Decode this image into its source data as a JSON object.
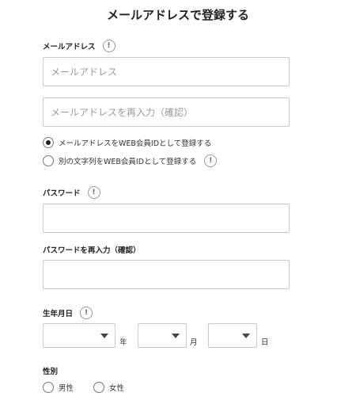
{
  "page": {
    "title": "メールアドレスで登録する"
  },
  "email": {
    "label": "メールアドレス",
    "help": "!",
    "placeholder": "メールアドレス",
    "confirm_placeholder": "メールアドレスを再入力（確認）"
  },
  "member_id": {
    "options": [
      {
        "label": "メールアドレスをWEB会員IDとして登録する",
        "checked": true
      },
      {
        "label": "別の文字列をWEB会員IDとして登録する",
        "checked": false
      }
    ],
    "help": "!"
  },
  "password": {
    "label": "パスワード",
    "help": "!",
    "value": ""
  },
  "password_confirm": {
    "label": "パスワードを再入力（確認）",
    "value": ""
  },
  "birthdate": {
    "label": "生年月日",
    "help": "!",
    "year_unit": "年",
    "month_unit": "月",
    "day_unit": "日",
    "year_value": "",
    "month_value": "",
    "day_value": ""
  },
  "gender": {
    "label": "性別",
    "options": [
      {
        "label": "男性",
        "checked": false
      },
      {
        "label": "女性",
        "checked": false
      }
    ]
  }
}
